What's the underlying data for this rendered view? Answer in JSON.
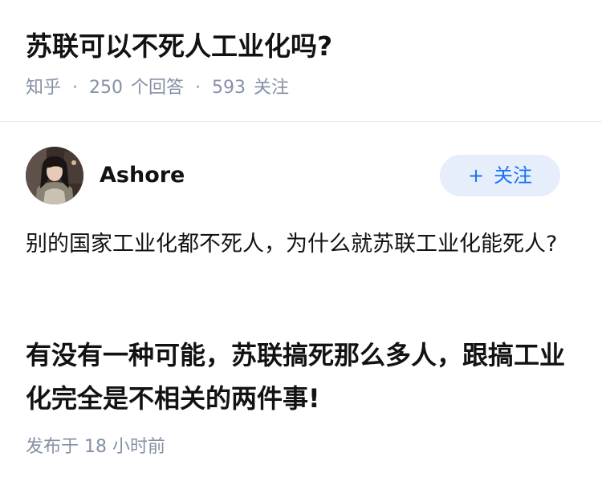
{
  "question": {
    "title": "苏联可以不死人工业化吗?",
    "source": "知乎",
    "separator": "·",
    "answers_count": "250",
    "answers_label": "个回答",
    "followers_count": "593",
    "followers_label": "关注"
  },
  "author": {
    "name": "Ashore",
    "follow_icon": "+",
    "follow_label": "关注"
  },
  "answer": {
    "paragraph1": "别的国家工业化都不死人，为什么就苏联工业化能死人?",
    "paragraph2": "有没有一种可能，苏联搞死那么多人，跟搞工业化完全是不相关的两件事!",
    "publish_time": "发布于 18 小时前"
  },
  "colors": {
    "text_primary": "#121212",
    "text_meta": "#8590a6",
    "follow_bg": "#e6eefc",
    "follow_text": "#1772f6",
    "divider": "#ebebeb"
  }
}
